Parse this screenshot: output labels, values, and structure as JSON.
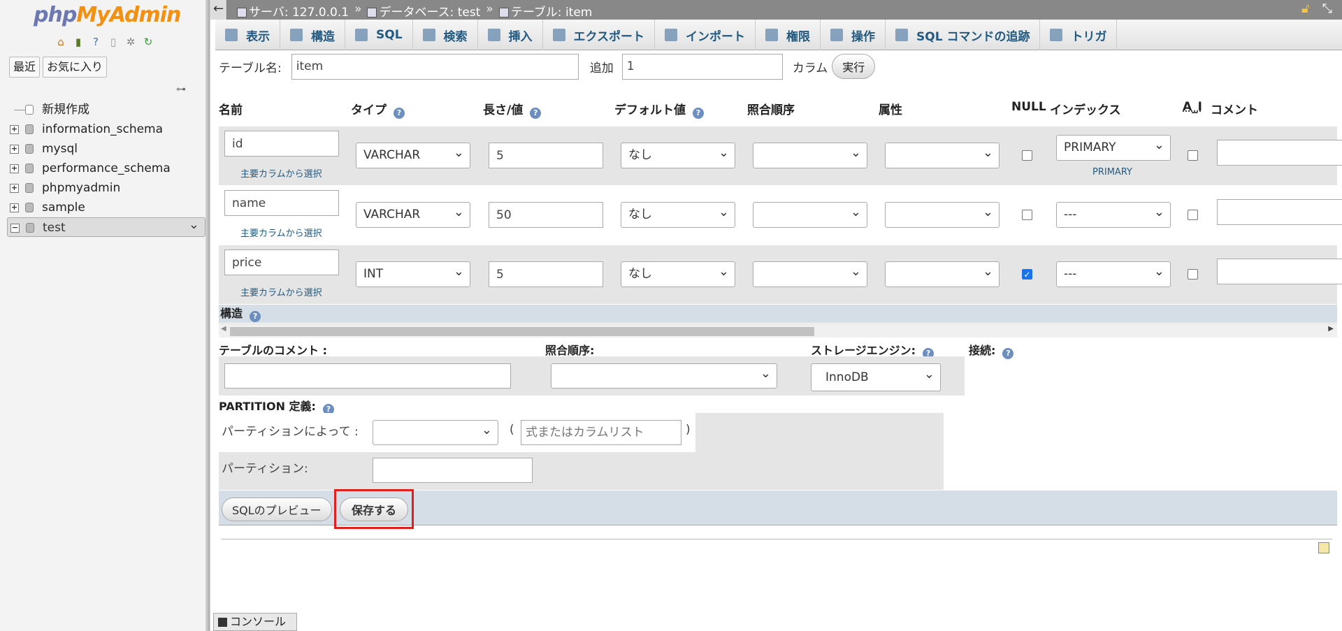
{
  "sidebar": {
    "logo_php": "php",
    "logo_myadmin": "MyAdmin",
    "tabs": [
      "最近",
      "お気に入り"
    ],
    "tree": [
      {
        "label": "新規作成",
        "type": "new"
      },
      {
        "label": "information_schema",
        "type": "db"
      },
      {
        "label": "mysql",
        "type": "db"
      },
      {
        "label": "performance_schema",
        "type": "db"
      },
      {
        "label": "phpmyadmin",
        "type": "db"
      },
      {
        "label": "sample",
        "type": "db"
      },
      {
        "label": "test",
        "type": "db",
        "selected": true
      }
    ]
  },
  "topbar": {
    "server": "サーバ:  127.0.0.1",
    "database": "データベース:  test",
    "table": "テーブル:  item",
    "sep": "»"
  },
  "menu": {
    "tabs": [
      "表示",
      "構造",
      "SQL",
      "検索",
      "挿入",
      "エクスポート",
      "インポート",
      "権限",
      "操作",
      "SQL コマンドの追跡",
      "トリガ"
    ]
  },
  "form": {
    "table_name_label": "テーブル名:",
    "table_name_value": "item",
    "add_label": "追加",
    "add_value": "1",
    "column_label": "カラム",
    "go_button": "実行"
  },
  "columns_header": {
    "name": "名前",
    "type": "タイプ",
    "length": "長さ/値",
    "default": "デフォルト値",
    "collation": "照合順序",
    "attributes": "属性",
    "null": "NULL",
    "index": "インデックス",
    "ai": "A_I",
    "comment": "コメント"
  },
  "columns": [
    {
      "name": "id",
      "type": "VARCHAR",
      "length": "5",
      "default": "なし",
      "null": false,
      "index": "PRIMARY",
      "index_note": "PRIMARY",
      "ai": false,
      "link": "主要カラムから選択"
    },
    {
      "name": "name",
      "type": "VARCHAR",
      "length": "50",
      "default": "なし",
      "null": false,
      "index": "---",
      "index_note": "",
      "ai": false,
      "link": "主要カラムから選択"
    },
    {
      "name": "price",
      "type": "INT",
      "length": "5",
      "default": "なし",
      "null": true,
      "index": "---",
      "index_note": "",
      "ai": false,
      "link": "主要カラムから選択"
    }
  ],
  "structure_label": "構造",
  "table_options": {
    "comment_label": "テーブルのコメント :",
    "collation_label": "照合順序:",
    "engine_label": "ストレージエンジン:",
    "engine_value": "InnoDB",
    "connection_label": "接続:"
  },
  "partition": {
    "title": "PARTITION 定義:",
    "by_label": "パーティションによって :",
    "paren_open": "(",
    "paren_close": ")",
    "expr_placeholder": "式またはカラムリスト",
    "partitions_label": "パーティション:"
  },
  "buttons": {
    "preview": "SQLのプレビュー",
    "save": "保存する"
  },
  "console": "コンソール",
  "colors": {
    "accent": "#235a81",
    "highlight": "#e02020"
  }
}
